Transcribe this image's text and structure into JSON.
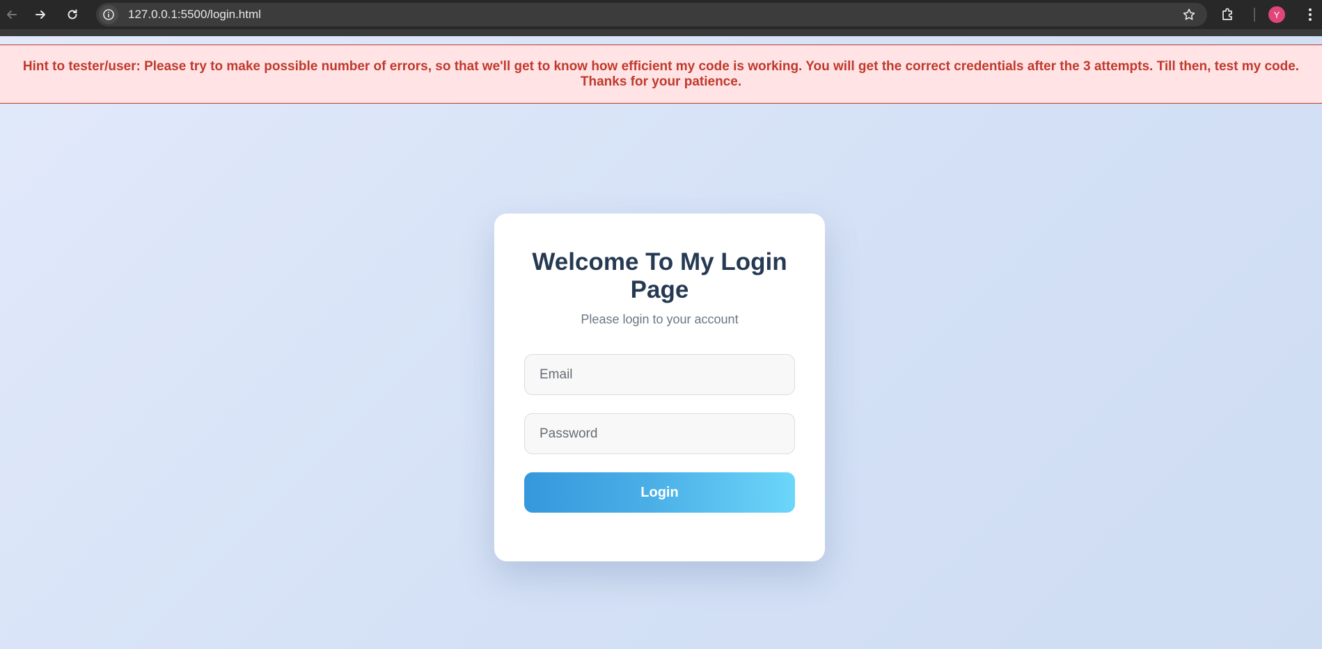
{
  "browser": {
    "url": "127.0.0.1:5500/login.html",
    "profile_initial": "Y",
    "icons": {
      "back": "back-arrow-icon",
      "forward": "forward-arrow-icon",
      "reload": "reload-icon",
      "site_info": "info-icon",
      "bookmark": "star-icon",
      "extensions": "puzzle-icon",
      "menu": "kebab-menu-icon"
    },
    "colors": {
      "chrome_bg": "#282828",
      "omnibox_bg": "#3c3c3c",
      "avatar_bg": "#e0457b"
    }
  },
  "hint": {
    "text": "Hint to tester/user: Please try to make possible number of errors, so that we'll get to know how efficient my code is working. You will get the correct credentials after the 3 attempts. Till then, test my code. Thanks for your patience.",
    "color": "#c0392b",
    "background": "#ffe3e5"
  },
  "login": {
    "title": "Welcome To My Login Page",
    "subtitle": "Please login to your account",
    "email_placeholder": "Email",
    "email_value": "",
    "password_placeholder": "Password",
    "password_value": "",
    "button_label": "Login",
    "colors": {
      "title": "#253a52",
      "button_start": "#3598dc",
      "button_end": "#6cd6fa"
    }
  }
}
